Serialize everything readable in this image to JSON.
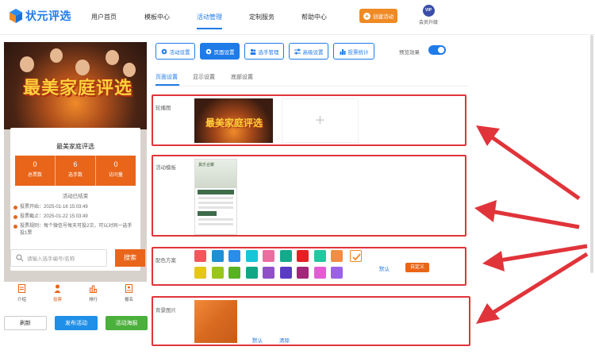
{
  "brand": {
    "name": "状元评选"
  },
  "nav": {
    "items": [
      "用户首页",
      "模板中心",
      "活动管理",
      "定制服务",
      "帮助中心"
    ],
    "active_index": 2,
    "create_label": "创建活动",
    "vip_badge": "VIP",
    "vip_label": "会员升级"
  },
  "preview": {
    "banner_title": "最美家庭评选",
    "card_title": "最美家庭评选",
    "stats": [
      {
        "value": "0",
        "label": "总票数"
      },
      {
        "value": "6",
        "label": "选手数"
      },
      {
        "value": "0",
        "label": "访问量"
      }
    ],
    "status": "活动已结束",
    "info": [
      "投票开始：2025-01-16 15:03:49",
      "投票截止：2025-01-22 15:03:49",
      "投票规则：每个微信号每天可投2次，可以对同一选手投1票"
    ],
    "search_placeholder": "请输入选手编号/名称",
    "search_button": "搜索",
    "tabs": [
      "介绍",
      "投票",
      "排行",
      "报名"
    ],
    "active_tab": 1
  },
  "actions": {
    "refresh": "刷新",
    "publish": "发布活动",
    "poster": "活动海报"
  },
  "toolbar": {
    "items": [
      "活动设置",
      "页面设置",
      "选手管理",
      "高级设置",
      "投票统计"
    ],
    "active_index": 1,
    "preview_label": "预览效果",
    "preview_on": true
  },
  "subtabs": {
    "items": [
      "页面设置",
      "显示设置",
      "底部设置"
    ],
    "active_index": 0
  },
  "settings": {
    "carousel_label": "轮播图",
    "carousel_image_title": "最美家庭评选",
    "add_symbol": "+",
    "template_label": "活动模板",
    "template_title": "其乐合聚",
    "color_label": "配色方案",
    "colors": [
      "#f0585c",
      "#1f8fd6",
      "#2a8de8",
      "#16c6d6",
      "#ec6ea0",
      "#15aa8c",
      "#e81f22",
      "#20c9a0",
      "#f58c44",
      "#e6c619",
      "#98c61a",
      "#58b224",
      "#11a684",
      "#9150c8",
      "#5a3cc4",
      "#a2277a",
      "#e25cd4",
      "#9b62e8"
    ],
    "color_default": "默认",
    "color_custom": "自定义",
    "bg_label": "背景图片",
    "bg_default": "默认",
    "bg_clear": "清除"
  }
}
